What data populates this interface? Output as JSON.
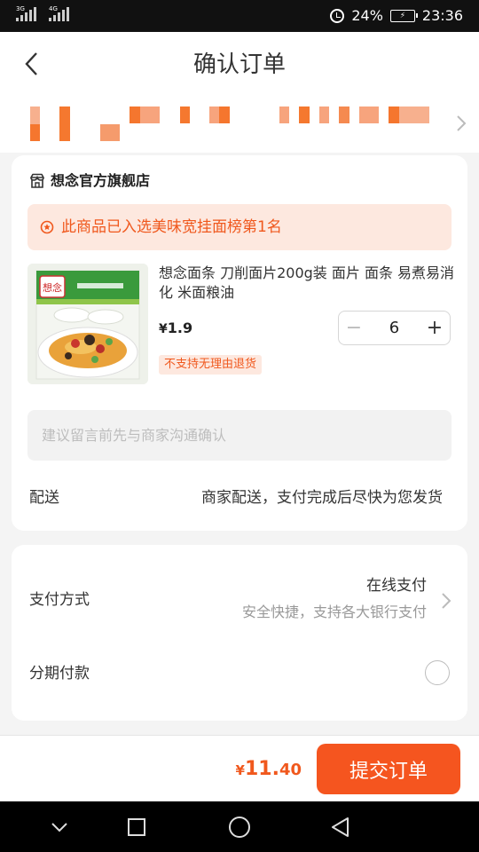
{
  "status_bar": {
    "network_1": "3G",
    "network_2": "4G",
    "battery": "24%",
    "time": "23:36"
  },
  "header": {
    "title": "确认订单"
  },
  "shop": {
    "name": "想念官方旗舰店"
  },
  "rank_banner": {
    "text": "此商品已入选美味宽挂面榜第1名"
  },
  "product": {
    "title": "想念面条 刀削面片200g装 面片 面条 易煮易消化 米面粮油",
    "price_symbol": "¥",
    "price": "1.9",
    "quantity": "6",
    "tag": "不支持无理由退货",
    "package_brand": "想念"
  },
  "remark": {
    "placeholder": "建议留言前先与商家沟通确认"
  },
  "shipping": {
    "label": "配送",
    "value": "商家配送，支付完成后尽快为您发货"
  },
  "payment": {
    "label": "支付方式",
    "value": "在线支付",
    "desc": "安全快捷，支持各大银行支付"
  },
  "installment": {
    "label": "分期付款"
  },
  "footer": {
    "currency": "¥",
    "total_int": "11.",
    "total_dec": "40",
    "submit_label": "提交订单"
  },
  "colors": {
    "accent": "#f5551f",
    "rank_bg": "#fde8df",
    "rank_text": "#f0581d"
  }
}
